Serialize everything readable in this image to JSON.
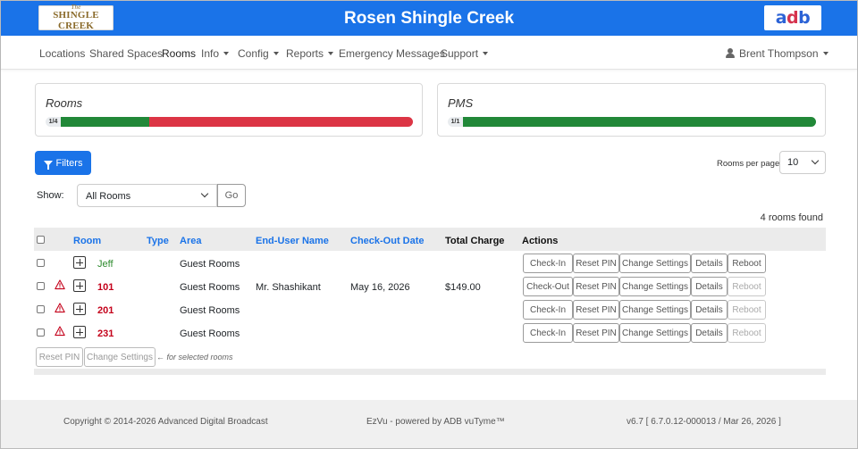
{
  "header": {
    "title": "Rosen Shingle Creek",
    "logo_left_top": "The",
    "logo_left": "SHINGLE CREEK",
    "logo_right_a": "a",
    "logo_right_d": "d",
    "logo_right_b": "b"
  },
  "nav": {
    "items": [
      "Locations",
      "Shared Spaces",
      "Rooms",
      "Info",
      "Config",
      "Reports",
      "Emergency Messages",
      "Support"
    ],
    "active": "Rooms",
    "user": "Brent Thompson"
  },
  "cards": {
    "rooms": {
      "title": "Rooms",
      "label": "1/4",
      "ok_fraction": 0.25
    },
    "pms": {
      "title": "PMS",
      "label": "1/1",
      "ok_fraction": 1.0
    }
  },
  "colors": {
    "accent": "#1a73e8",
    "ok": "#218838",
    "bad": "#dc3545"
  },
  "filters": {
    "button_label": "Filters",
    "rooms_per_page_label": "Rooms per page",
    "rooms_per_page": "10"
  },
  "show": {
    "label": "Show:",
    "selected": "All Rooms",
    "go_label": "Go"
  },
  "found_text": "4 rooms found",
  "table": {
    "headers": {
      "room": "Room",
      "type": "Type",
      "area": "Area",
      "end_user": "End-User Name",
      "checkout": "Check-Out Date",
      "charge": "Total Charge",
      "actions": "Actions"
    },
    "rows": [
      {
        "room": "Jeff",
        "status": "ok",
        "area": "Guest Rooms",
        "end_user": "",
        "checkout": "",
        "charge": "",
        "check_action": "Check-In",
        "reboot_enabled": true
      },
      {
        "room": "101",
        "status": "warn",
        "area": "Guest Rooms",
        "end_user": "Mr. Shashikant",
        "checkout": "May 16, 2026",
        "charge": "$149.00",
        "check_action": "Check-Out",
        "reboot_enabled": false
      },
      {
        "room": "201",
        "status": "warn",
        "area": "Guest Rooms",
        "end_user": "",
        "checkout": "",
        "charge": "",
        "check_action": "Check-In",
        "reboot_enabled": false
      },
      {
        "room": "231",
        "status": "warn",
        "area": "Guest Rooms",
        "end_user": "",
        "checkout": "",
        "charge": "",
        "check_action": "Check-In",
        "reboot_enabled": false
      }
    ],
    "row_actions": {
      "reset_pin": "Reset PIN",
      "change_settings": "Change Settings",
      "details": "Details",
      "reboot": "Reboot"
    },
    "bulk": {
      "reset_pin": "Reset PIN",
      "change_settings": "Change Settings",
      "note": "← for selected rooms"
    }
  },
  "footer": {
    "copyright": "Copyright © 2014-2026 Advanced Digital Broadcast",
    "product": "EzVu - powered by ADB vuTyme™",
    "version": "v6.7 [ 6.7.0.12-000013 / Mar 26, 2026 ]"
  }
}
